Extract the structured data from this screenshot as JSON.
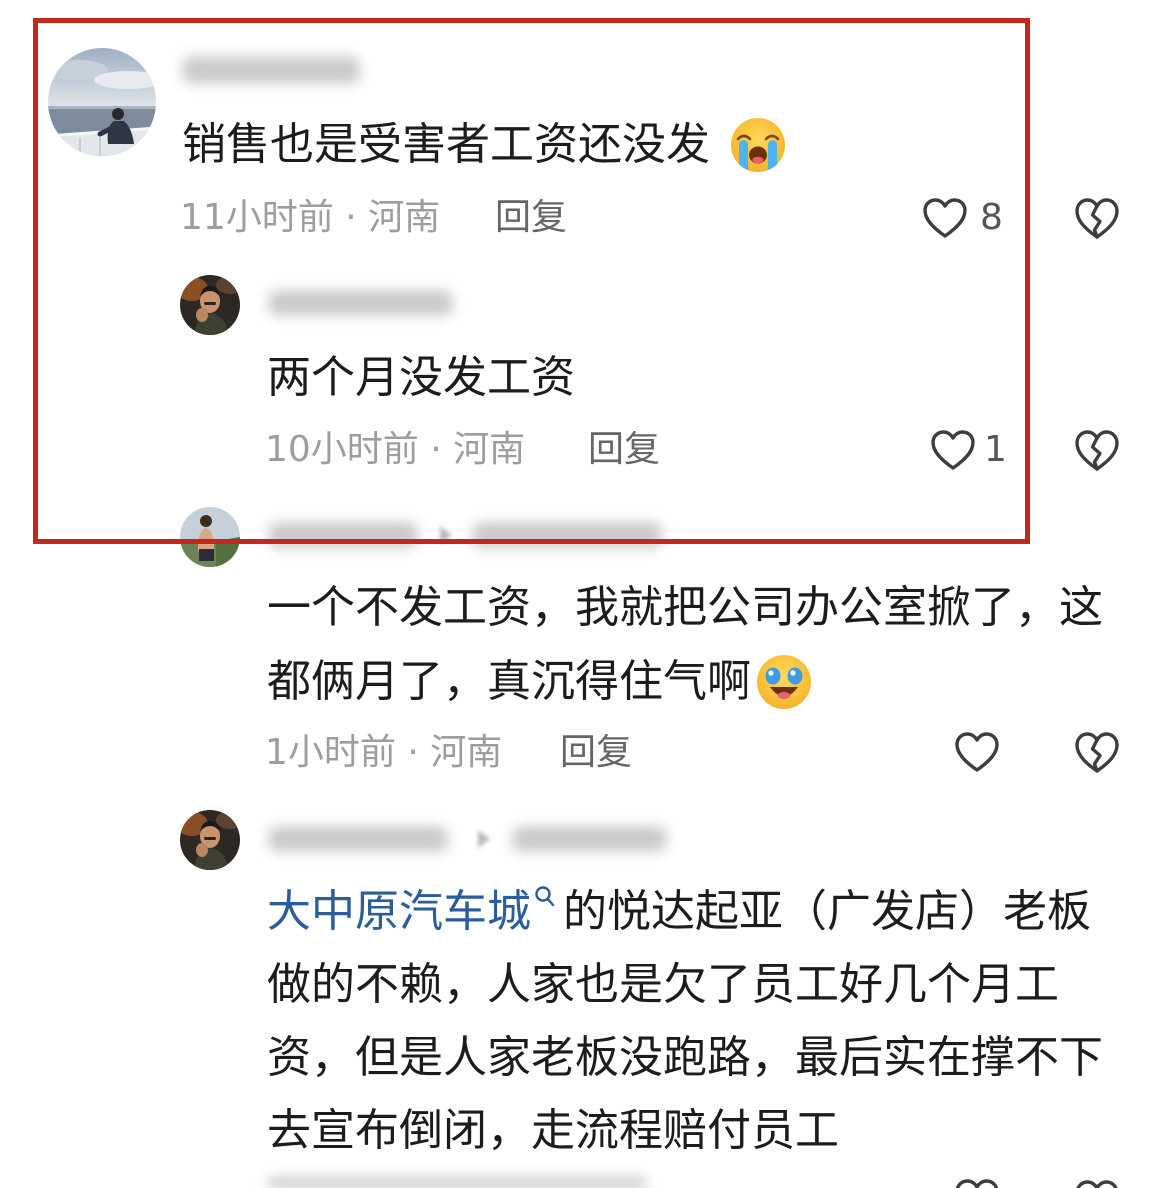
{
  "colors": {
    "highlight_box": "#c3281e",
    "text": "#1c1c1c",
    "meta": "#9d9d9d",
    "reply": "#666666",
    "count": "#555555",
    "link": "#2a5d9c",
    "icon": "#3d3d3d"
  },
  "comments": [
    {
      "lines": [
        "销售也是受害者工资还没发"
      ],
      "emoji": "loudly-crying-emoji",
      "meta": "11小时前 · 河南",
      "reply_label": "回复",
      "like_icon": "heart-outline-icon",
      "like_count": "8",
      "dislike_icon": "broken-heart-icon"
    },
    {
      "lines": [
        "两个月没发工资"
      ],
      "meta": "10小时前 · 河南",
      "reply_label": "回复",
      "like_icon": "heart-outline-icon",
      "like_count": "1",
      "dislike_icon": "broken-heart-icon"
    },
    {
      "lines": [
        "一个不发工资，我就把公司办公室掀了，这",
        "都俩月了，真沉得住气啊"
      ],
      "emoji": "laughing-crying-emoji",
      "meta": "1小时前 · 河南",
      "reply_label": "回复",
      "like_icon": "heart-outline-icon",
      "dislike_icon": "broken-heart-icon"
    },
    {
      "link": {
        "text": "大中原汽车城",
        "icon": "search-icon"
      },
      "lines": [
        "的悦达起亚（广发店）老板",
        "做的不赖，人家也是欠了员工好几个月工",
        "资，但是人家老板没跑路，最后实在撑不下",
        "去宣布倒闭，走流程赔付员工"
      ],
      "like_icon": "heart-outline-icon",
      "dislike_icon": "broken-heart-icon"
    }
  ]
}
